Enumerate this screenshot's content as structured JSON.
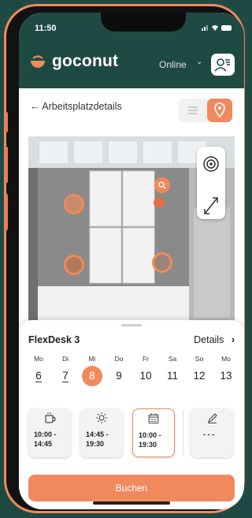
{
  "colors": {
    "accent": "#f08a5d",
    "header": "#1f4a44"
  },
  "status": {
    "time": "11:50",
    "icons": "signal-icon wifi-icon battery-icon"
  },
  "header": {
    "logo_text": "goconut",
    "status_select": "Online",
    "profile_icon": "profile-menu-icon"
  },
  "nav": {
    "back_label": "Arbeitsplatzdetails"
  },
  "sheet": {
    "desk_name": "FlexDesk 3",
    "details_label": "Details",
    "days": [
      {
        "label": "Mo",
        "num": "6"
      },
      {
        "label": "Di",
        "num": "7"
      },
      {
        "label": "Mi",
        "num": "8"
      },
      {
        "label": "Do",
        "num": "9"
      },
      {
        "label": "Fr",
        "num": "10"
      },
      {
        "label": "Sa",
        "num": "11"
      },
      {
        "label": "So",
        "num": "12"
      },
      {
        "label": "Mo",
        "num": "13"
      }
    ],
    "selected_day_index": 2,
    "slots": [
      {
        "icon": "coffee-icon",
        "line1": "10:00 -",
        "line2": "14:45"
      },
      {
        "icon": "sun-icon",
        "line1": "14:45 -",
        "line2": "19:30"
      },
      {
        "icon": "calendar-icon",
        "line1": "10:00 -",
        "line2": "19:30"
      },
      {
        "icon": "pencil-icon",
        "line1": "- - -",
        "line2": ""
      }
    ],
    "book_label": "Buchen"
  }
}
